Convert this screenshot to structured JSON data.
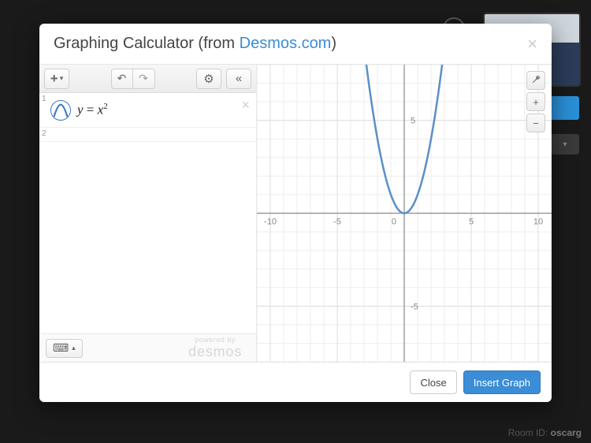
{
  "background": {
    "room_label": "Room ID:",
    "room_value": "oscarg"
  },
  "modal": {
    "title_prefix": "Graphing Calculator (from ",
    "title_link": "Desmos.com",
    "title_suffix": ")",
    "close_x": "×"
  },
  "toolbar": {
    "add_label": "+",
    "add_caret": "▾",
    "undo_glyph": "↶",
    "redo_glyph": "↷",
    "settings_glyph": "⚙",
    "collapse_glyph": "«"
  },
  "expressions": [
    {
      "index": "1",
      "formula_y": "y",
      "formula_eq": " = ",
      "formula_x": "x",
      "formula_exp": "2",
      "icon": "parabola"
    },
    {
      "index": "2",
      "empty": true
    }
  ],
  "row_delete_x": "×",
  "keyboard": {
    "glyph": "⌨",
    "caret": "▴"
  },
  "powered": {
    "top": "powered by",
    "brand": "desmos"
  },
  "graph_tools": {
    "wrench": "🔧",
    "plus": "+",
    "minus": "−"
  },
  "footer": {
    "close": "Close",
    "insert": "Insert Graph"
  },
  "chart_data": {
    "type": "line",
    "title": "",
    "xlabel": "",
    "ylabel": "",
    "xticks": [
      -10,
      -5,
      0,
      5,
      10
    ],
    "yticks": [
      -5,
      5
    ],
    "xlim": [
      -11,
      11
    ],
    "ylim": [
      -8,
      8
    ],
    "grid": true,
    "series": [
      {
        "name": "y = x^2",
        "color": "#5b8fc7",
        "x": [
          -3,
          -2.5,
          -2,
          -1.5,
          -1,
          -0.5,
          0,
          0.5,
          1,
          1.5,
          2,
          2.5,
          3
        ],
        "y": [
          9,
          6.25,
          4,
          2.25,
          1,
          0.25,
          0,
          0.25,
          1,
          2.25,
          4,
          6.25,
          9
        ]
      }
    ]
  }
}
